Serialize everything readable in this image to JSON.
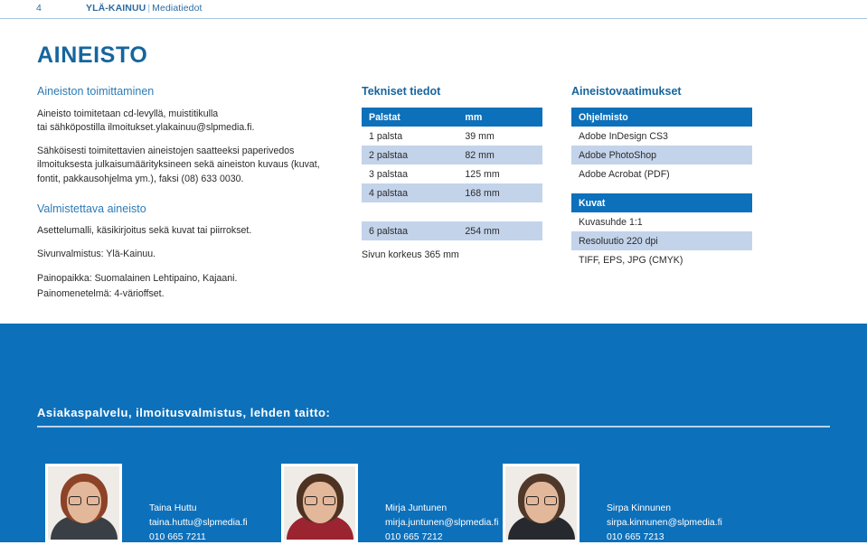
{
  "running_header": {
    "page_number": "4",
    "publication": "YLÄ-KAINUU",
    "separator": "|",
    "section": "Mediatiedot"
  },
  "section_title": "AINEISTO",
  "left_column": {
    "heading": "Aineiston toimittaminen",
    "paragraph_1_line_1": "Aineisto toimitetaan cd-levyllä, muistitikulla",
    "paragraph_1_line_2": "tai sähköpostilla ilmoitukset.ylakainuu@slpmedia.fi.",
    "paragraph_2": "Sähköisesti toimitettavien aineistojen saatteeksi paperivedos ilmoituksesta julkaisumäärityksineen sekä aineiston kuvaus (kuvat, fontit, pakkausohjelma ym.), faksi (08) 633 0030.",
    "subheading": "Valmistettava aineisto",
    "line_1": "Asettelumalli, käsikirjoitus sekä kuvat tai piirrokset.",
    "line_2": "Sivunvalmistus: Ylä-Kainuu.",
    "line_3": "Painopaikka: Suomalainen Lehtipaino, Kajaani.",
    "line_4": "Painomenetelmä: 4-värioffset."
  },
  "middle_column": {
    "heading": "Tekniset tiedot",
    "table": {
      "columns": [
        "Palstat",
        "mm"
      ],
      "rows": [
        [
          "1 palsta",
          "39 mm"
        ],
        [
          "2 palstaa",
          "82 mm"
        ],
        [
          "3 palstaa",
          "125 mm"
        ],
        [
          "4 palstaa",
          "168 mm"
        ],
        [
          "",
          ""
        ],
        [
          "6 palstaa",
          "254 mm"
        ]
      ]
    },
    "note": "Sivun korkeus 365 mm"
  },
  "right_column": {
    "heading": "Aineistovaatimukset",
    "table_software": {
      "header": "Ohjelmisto",
      "rows": [
        "Adobe InDesign CS3",
        "Adobe PhotoShop",
        "Adobe Acrobat (PDF)"
      ]
    },
    "table_images": {
      "header": "Kuvat",
      "rows": [
        "Kuvasuhde 1:1",
        "Resoluutio 220 dpi",
        "TIFF, EPS, JPG (CMYK)"
      ]
    }
  },
  "footer": {
    "heading": "Asiakaspalvelu, ilmoitusvalmistus, lehden taitto:",
    "people": [
      {
        "name": "Taina Huttu",
        "email": "taina.huttu@slpmedia.fi",
        "phone": "010 665 7211"
      },
      {
        "name": "Mirja Juntunen",
        "email": "mirja.juntunen@slpmedia.fi",
        "phone": "010 665 7212"
      },
      {
        "name": "Sirpa Kinnunen",
        "email": "sirpa.kinnunen@slpmedia.fi",
        "phone": "010 665 7213"
      }
    ]
  },
  "colors": {
    "brand_blue": "#0d70ba",
    "title_blue": "#16659e",
    "heading_blue": "#2d7bb5",
    "table_alt_row": "#c3d3ea",
    "rule_blue": "#a9c7de"
  }
}
